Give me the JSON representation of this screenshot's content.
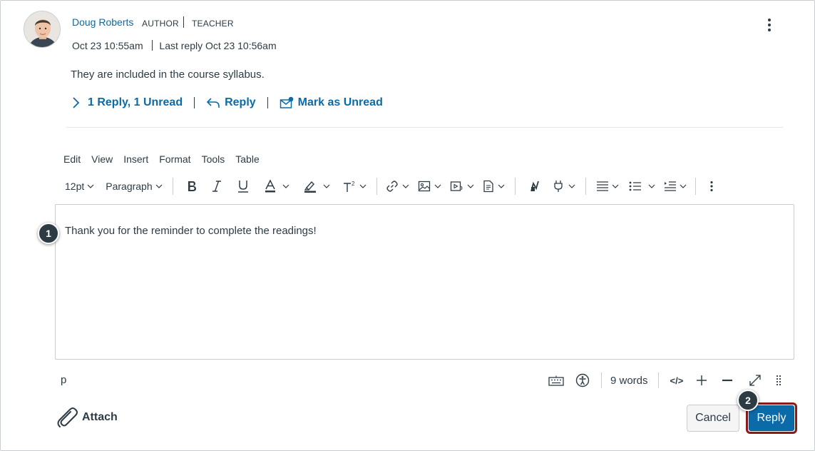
{
  "post": {
    "author": "Doug Roberts",
    "role1": "AUTHOR",
    "role2": "TEACHER",
    "timestamp": "Oct 23 10:55am",
    "last_reply": "Last reply Oct 23 10:56am",
    "message": "They are included in the course syllabus.",
    "actions": {
      "replies": "1 Reply, 1 Unread",
      "reply": "Reply",
      "mark_unread": "Mark as Unread"
    }
  },
  "editor": {
    "menubar": [
      "Edit",
      "View",
      "Insert",
      "Format",
      "Tools",
      "Table"
    ],
    "font_size": "12pt",
    "block_format": "Paragraph",
    "content": "Thank you for the reminder to complete the readings!",
    "status_path": "p",
    "word_count": "9 words",
    "html_toggle": "</>"
  },
  "footer": {
    "attach": "Attach",
    "cancel": "Cancel",
    "reply": "Reply"
  },
  "callouts": [
    "1",
    "2"
  ],
  "colors": {
    "link": "#0b6ba8",
    "text": "#2d3b45",
    "primary": "#0b6ba8",
    "highlight_ring": "#8b1a1a"
  },
  "icons": [
    "chevron-right-icon",
    "reply-arrow-icon",
    "mail-unread-icon",
    "kebab-menu-icon",
    "bold-icon",
    "italic-icon",
    "underline-icon",
    "text-color-icon",
    "highlight-icon",
    "superscript-icon",
    "link-icon",
    "image-icon",
    "media-icon",
    "document-icon",
    "equation-icon",
    "plugin-icon",
    "align-icon",
    "bullet-list-icon",
    "indent-icon",
    "keyboard-icon",
    "accessibility-icon",
    "fullscreen-icon",
    "resize-grip-icon",
    "paperclip-icon"
  ]
}
